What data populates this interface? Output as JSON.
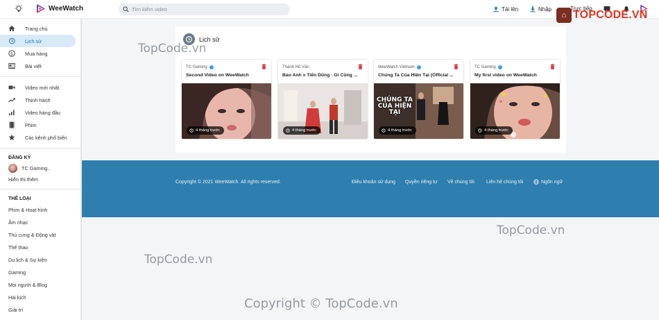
{
  "header": {
    "brand": "WeeWatch",
    "search_placeholder": "Tìm kiếm video",
    "upload_label": "Tải lên",
    "import_label": "Nhập",
    "live_label": "Trực tiếp"
  },
  "sidebar": {
    "items": [
      {
        "label": "Trang chủ",
        "icon": "home-icon"
      },
      {
        "label": "Lịch sử",
        "icon": "history-icon",
        "active": true
      },
      {
        "label": "Mua hàng",
        "icon": "dollar-icon"
      },
      {
        "label": "Bài viết",
        "icon": "article-icon"
      }
    ],
    "items2": [
      {
        "label": "Video mới nhất",
        "icon": "video-camera-icon"
      },
      {
        "label": "Thịnh hành",
        "icon": "trending-icon"
      },
      {
        "label": "Video hàng đầu",
        "icon": "bar-chart-icon"
      },
      {
        "label": "Phim",
        "icon": "film-icon"
      },
      {
        "label": "Các kênh phổ biến",
        "icon": "star-icon"
      }
    ],
    "subscriptions_heading": "ĐĂNG KÝ",
    "subscription_channel": "TC Gaming..",
    "show_more": "Hiển thị thêm",
    "categories_heading": "THỂ LOẠI",
    "categories": [
      "Phim & Hoạt hình",
      "Âm nhạc",
      "Thú cưng & Động vật",
      "Thể thao",
      "Du lịch & Sự kiện",
      "Gaming",
      "Mọi người & Blog",
      "Hài kịch",
      "Giải trí"
    ]
  },
  "history": {
    "title": "Lịch sử",
    "videos": [
      {
        "channel": "TC Gaming",
        "title": "Second Video on WeeWatch",
        "time": "4 tháng trước"
      },
      {
        "channel": "Thành Hồ Văn",
        "title": "Bảo Anh x Tiến Dũng - Gì Cũng ...",
        "time": "4 tháng trước"
      },
      {
        "channel": "WeeWatch Vietnam",
        "title": "Chúng Ta Của Hiện Tại (Official ...",
        "time": "4 tháng trước",
        "thumb_text": "CHÚNG TA CỦA HIỆN TẠI"
      },
      {
        "channel": "TC Gaming",
        "title": "My first video on WeeWatch",
        "time": "4 tháng trước"
      }
    ]
  },
  "footer": {
    "copyright": "Copyright © 2021 WeeWatch. All rights reserved.",
    "links": [
      "Điều khoản sử dụng",
      "Quyền riêng tư",
      "Về chúng tôi",
      "Liên hệ chúng tôi"
    ],
    "language": "Ngôn ngữ"
  },
  "watermark": {
    "brand": "TOPCODE.VN",
    "text": "TopCode.vn",
    "copyright": "Copyright © TopCode.vn"
  },
  "colors": {
    "accent": "#1a6fb0",
    "footer_bg": "#2e7fae",
    "active_bg": "#d8eaf7",
    "delete_red": "#d93b3b"
  }
}
